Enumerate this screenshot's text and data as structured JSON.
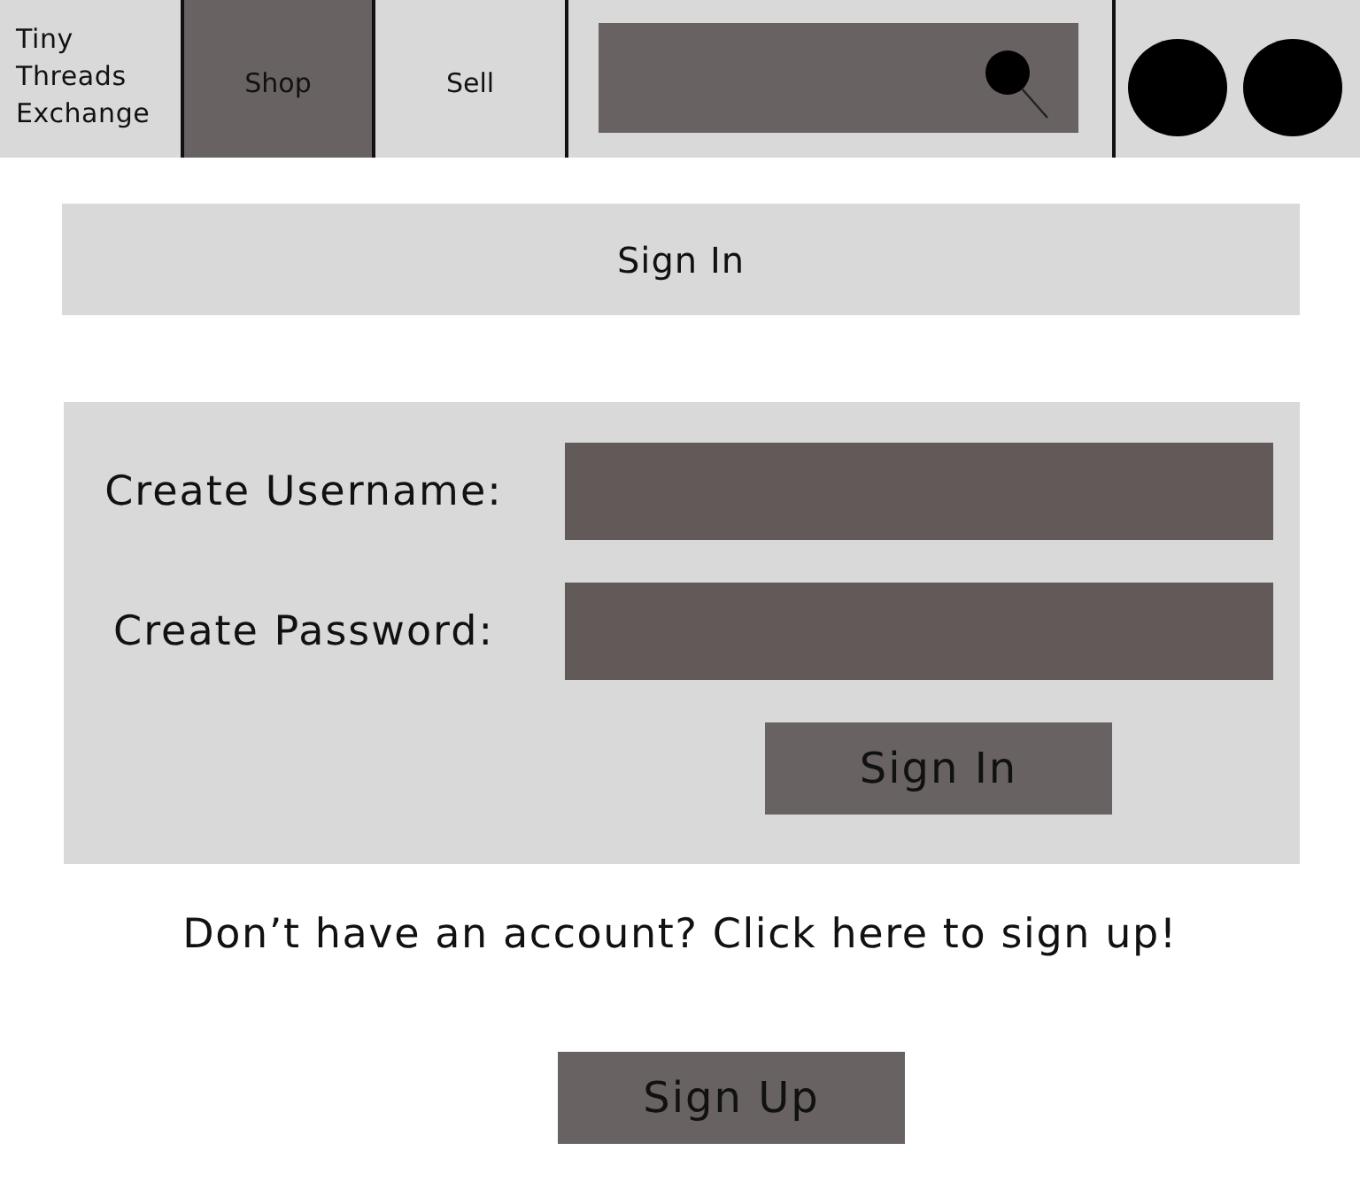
{
  "header": {
    "logo": "Tiny Threads Exchange",
    "tabs": [
      {
        "label": "Shop",
        "selected": true
      },
      {
        "label": "Sell",
        "selected": false
      }
    ]
  },
  "title_bar": {
    "title": "Sign In"
  },
  "form": {
    "fields": [
      {
        "label": "Create Username:"
      },
      {
        "label": "Create Password:"
      }
    ],
    "submit": "Sign In"
  },
  "signup": {
    "prompt": "Don’t have an account? Click here to sign up!",
    "button": "Sign Up"
  }
}
